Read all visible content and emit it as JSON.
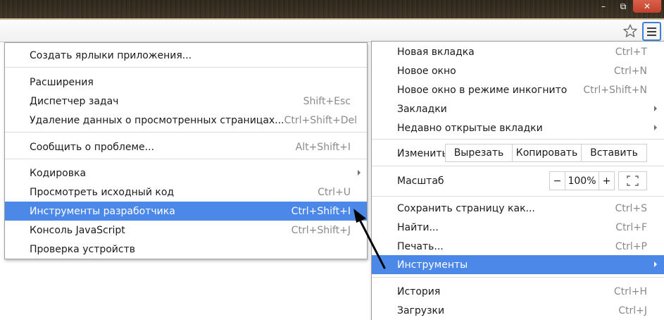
{
  "window": {
    "minimize_glyph": "–",
    "restore_glyph": "⧉",
    "close_glyph": "✕"
  },
  "colors": {
    "highlight": "#4c88e8",
    "menu_border": "#9e9e9e",
    "shortcut_text": "#8a8a8a"
  },
  "icons": {
    "bookmark_star": "star-icon",
    "menu": "hamburger-menu-icon",
    "submenu": "chevron-right-icon",
    "fullscreen": "fullscreen-icon"
  },
  "tools_submenu": {
    "items": [
      {
        "label": "Создать ярлыки приложения...",
        "shortcut": ""
      },
      {
        "label": "Расширения",
        "shortcut": ""
      },
      {
        "label": "Диспетчер задач",
        "shortcut": "Shift+Esc"
      },
      {
        "label": "Удаление данных о просмотренных страницах...",
        "shortcut": "Ctrl+Shift+Del"
      },
      {
        "label": "Сообщить о проблеме...",
        "shortcut": "Alt+Shift+I"
      },
      {
        "label": "Кодировка",
        "shortcut": ""
      },
      {
        "label": "Просмотреть исходный код",
        "shortcut": "Ctrl+U"
      },
      {
        "label": "Инструменты разработчика",
        "shortcut": "Ctrl+Shift+I"
      },
      {
        "label": "Консоль JavaScript",
        "shortcut": "Ctrl+Shift+J"
      },
      {
        "label": "Проверка устройств",
        "shortcut": ""
      }
    ]
  },
  "main_menu": {
    "items": [
      {
        "label": "Новая вкладка",
        "shortcut": "Ctrl+T"
      },
      {
        "label": "Новое окно",
        "shortcut": "Ctrl+N"
      },
      {
        "label": "Новое окно в режиме инкогнито",
        "shortcut": "Ctrl+Shift+N"
      },
      {
        "label": "Закладки",
        "shortcut": ""
      },
      {
        "label": "Недавно открытые вкладки",
        "shortcut": ""
      }
    ],
    "edit": {
      "label": "Изменить",
      "cut": "Вырезать",
      "copy": "Копировать",
      "paste": "Вставить"
    },
    "zoom": {
      "label": "Масштаб",
      "minus": "−",
      "value": "100%",
      "plus": "+"
    },
    "items2": [
      {
        "label": "Сохранить страницу как...",
        "shortcut": "Ctrl+S"
      },
      {
        "label": "Найти...",
        "shortcut": "Ctrl+F"
      },
      {
        "label": "Печать...",
        "shortcut": "Ctrl+P"
      },
      {
        "label": "Инструменты",
        "shortcut": ""
      }
    ],
    "items3": [
      {
        "label": "История",
        "shortcut": "Ctrl+H"
      },
      {
        "label": "Загрузки",
        "shortcut": "Ctrl+J"
      }
    ]
  }
}
